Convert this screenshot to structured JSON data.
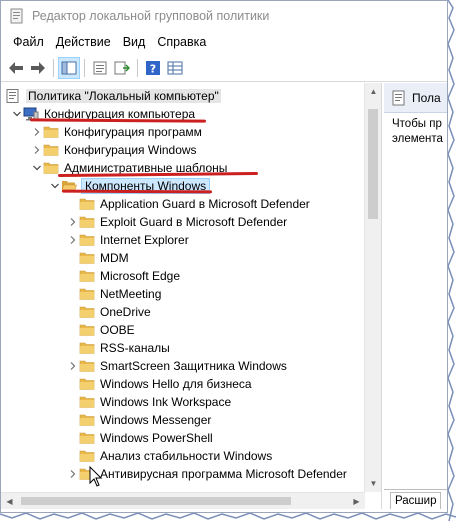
{
  "window": {
    "title": "Редактор локальной групповой политики"
  },
  "menu": [
    "Файл",
    "Действие",
    "Вид",
    "Справка"
  ],
  "tree": {
    "root": "Политика \"Локальный компьютер\"",
    "items": [
      {
        "label": "Конфигурация компьютера",
        "level": 1,
        "expander": "open",
        "icon": "computer-icon"
      },
      {
        "label": "Конфигурация программ",
        "level": 2,
        "expander": "closed",
        "icon": "folder-icon"
      },
      {
        "label": "Конфигурация Windows",
        "level": 2,
        "expander": "closed",
        "icon": "folder-icon"
      },
      {
        "label": "Административные шаблоны",
        "level": 2,
        "expander": "open",
        "icon": "folder-icon"
      },
      {
        "label": "Компоненты Windows",
        "level": 3,
        "expander": "open",
        "icon": "folder-open-icon",
        "selected": true
      },
      {
        "label": "Application Guard в Microsoft Defender",
        "level": 4,
        "expander": "none",
        "icon": "folder-icon"
      },
      {
        "label": "Exploit Guard в Microsoft Defender",
        "level": 4,
        "expander": "closed",
        "icon": "folder-icon"
      },
      {
        "label": "Internet Explorer",
        "level": 4,
        "expander": "closed",
        "icon": "folder-icon"
      },
      {
        "label": "MDM",
        "level": 4,
        "expander": "none",
        "icon": "folder-icon"
      },
      {
        "label": "Microsoft Edge",
        "level": 4,
        "expander": "none",
        "icon": "folder-icon"
      },
      {
        "label": "NetMeeting",
        "level": 4,
        "expander": "none",
        "icon": "folder-icon"
      },
      {
        "label": "OneDrive",
        "level": 4,
        "expander": "none",
        "icon": "folder-icon"
      },
      {
        "label": "OOBE",
        "level": 4,
        "expander": "none",
        "icon": "folder-icon"
      },
      {
        "label": "RSS-каналы",
        "level": 4,
        "expander": "none",
        "icon": "folder-icon"
      },
      {
        "label": "SmartScreen Защитника Windows",
        "level": 4,
        "expander": "closed",
        "icon": "folder-icon"
      },
      {
        "label": "Windows Hello для бизнеса",
        "level": 4,
        "expander": "none",
        "icon": "folder-icon"
      },
      {
        "label": "Windows Ink Workspace",
        "level": 4,
        "expander": "none",
        "icon": "folder-icon"
      },
      {
        "label": "Windows Messenger",
        "level": 4,
        "expander": "none",
        "icon": "folder-icon"
      },
      {
        "label": "Windows PowerShell",
        "level": 4,
        "expander": "none",
        "icon": "folder-icon"
      },
      {
        "label": "Анализ стабильности Windows",
        "level": 4,
        "expander": "none",
        "icon": "folder-icon"
      },
      {
        "label": "Антивирусная программа Microsoft Defender",
        "level": 4,
        "expander": "closed",
        "icon": "folder-icon"
      }
    ]
  },
  "right_pane": {
    "header": "Пола",
    "description": "Чтобы пр элемента",
    "tab_label": "Расшир"
  },
  "colors": {
    "selection_bg": "#cce8ff",
    "selection_border": "#99d1ff",
    "annotation_red": "#cc1f1f",
    "folder": "#e8b84a",
    "border_jag": "#7a8fb8"
  }
}
